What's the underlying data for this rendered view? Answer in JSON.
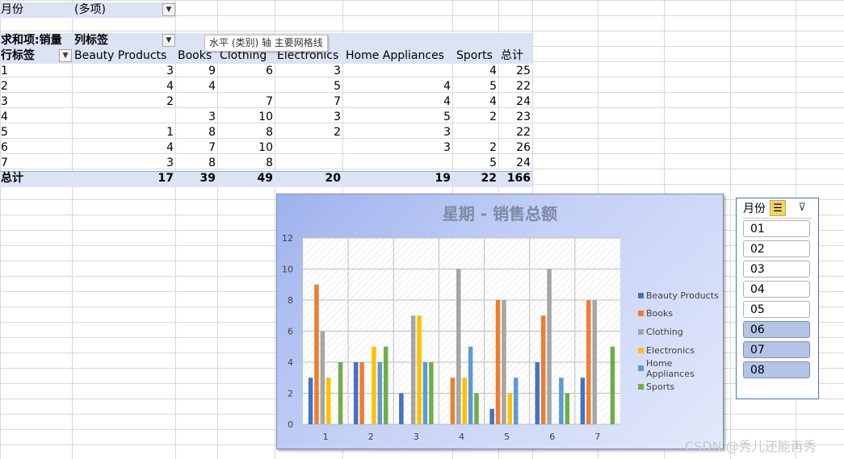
{
  "filter": {
    "label": "月份",
    "value": "(多项)"
  },
  "pivot": {
    "value_header": "求和项:销量",
    "column_header": "列标签",
    "row_header": "行标签",
    "columns": [
      "Beauty Products",
      "Books",
      "Clothing",
      "Electronics",
      "Home Appliances",
      "Sports",
      "总计"
    ],
    "rows": [
      {
        "label": "1",
        "cells": [
          "3",
          "9",
          "6",
          "3",
          "",
          "4",
          "25"
        ]
      },
      {
        "label": "2",
        "cells": [
          "4",
          "4",
          "",
          "5",
          "4",
          "5",
          "22"
        ]
      },
      {
        "label": "3",
        "cells": [
          "2",
          "",
          "7",
          "7",
          "4",
          "4",
          "24"
        ]
      },
      {
        "label": "4",
        "cells": [
          "",
          "3",
          "10",
          "3",
          "5",
          "2",
          "23"
        ]
      },
      {
        "label": "5",
        "cells": [
          "1",
          "8",
          "8",
          "2",
          "3",
          "",
          "22"
        ]
      },
      {
        "label": "6",
        "cells": [
          "4",
          "7",
          "10",
          "",
          "3",
          "2",
          "26"
        ]
      },
      {
        "label": "7",
        "cells": [
          "3",
          "8",
          "8",
          "",
          "",
          "5",
          "24"
        ]
      }
    ],
    "total": {
      "label": "总计",
      "cells": [
        "17",
        "39",
        "49",
        "20",
        "19",
        "22",
        "166"
      ]
    }
  },
  "tooltip": "水平 (类别) 轴 主要网格线",
  "chart_data": {
    "type": "bar",
    "title": "星期 - 销售总额",
    "categories": [
      "1",
      "2",
      "3",
      "4",
      "5",
      "6",
      "7"
    ],
    "ylim": [
      0,
      12
    ],
    "yticks": [
      0,
      2,
      4,
      6,
      8,
      10,
      12
    ],
    "legend_position": "right",
    "series": [
      {
        "name": "Beauty Products",
        "color": "#4472c4",
        "values": [
          3,
          4,
          2,
          0,
          1,
          4,
          3
        ]
      },
      {
        "name": "Books",
        "color": "#ed7d31",
        "values": [
          9,
          4,
          0,
          3,
          8,
          7,
          8
        ]
      },
      {
        "name": "Clothing",
        "color": "#a5a5a5",
        "values": [
          6,
          0,
          7,
          10,
          8,
          10,
          8
        ]
      },
      {
        "name": "Electronics",
        "color": "#ffc000",
        "values": [
          3,
          5,
          7,
          3,
          2,
          0,
          0
        ]
      },
      {
        "name": "Home Appliances",
        "color": "#5b9bd5",
        "values": [
          0,
          4,
          4,
          5,
          3,
          3,
          0
        ]
      },
      {
        "name": "Sports",
        "color": "#70ad47",
        "values": [
          4,
          5,
          4,
          2,
          0,
          2,
          5
        ]
      }
    ]
  },
  "slicer": {
    "title": "月份",
    "items": [
      {
        "label": "01",
        "selected": false
      },
      {
        "label": "02",
        "selected": false
      },
      {
        "label": "03",
        "selected": false
      },
      {
        "label": "04",
        "selected": false
      },
      {
        "label": "05",
        "selected": false
      },
      {
        "label": "06",
        "selected": true
      },
      {
        "label": "07",
        "selected": true
      },
      {
        "label": "08",
        "selected": true
      }
    ]
  },
  "watermark": "CSDN @秀儿还能再秀"
}
